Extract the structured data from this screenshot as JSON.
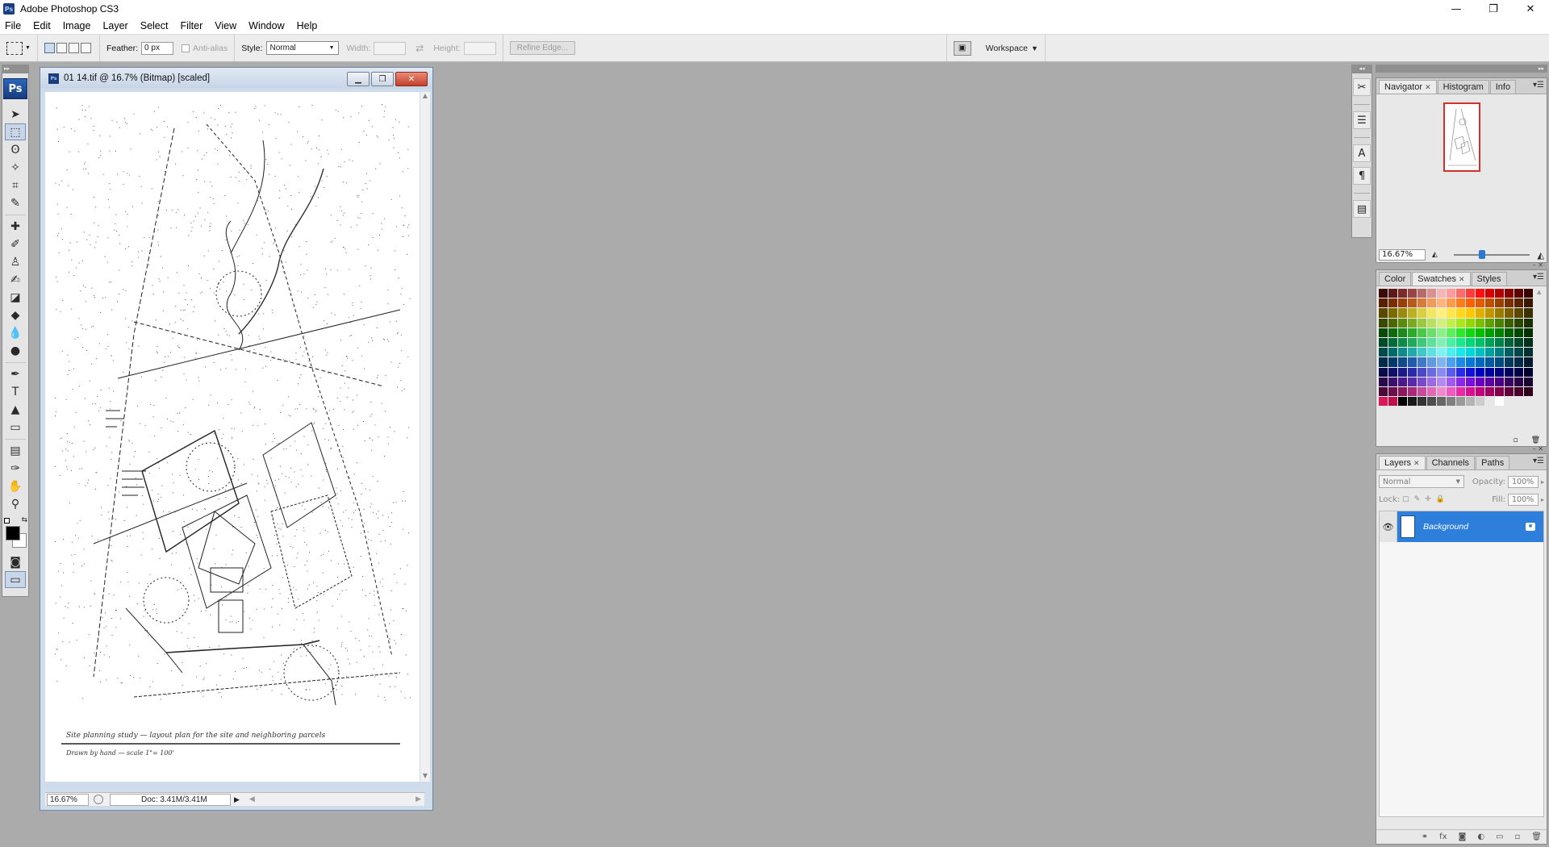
{
  "app": {
    "title": "Adobe Photoshop CS3",
    "logo": "Ps",
    "window_controls": [
      "—",
      "❐",
      "✕"
    ]
  },
  "menu": [
    "File",
    "Edit",
    "Image",
    "Layer",
    "Select",
    "Filter",
    "View",
    "Window",
    "Help"
  ],
  "options_bar": {
    "feather_label": "Feather:",
    "feather_value": "0 px",
    "antialias_label": "Anti-alias",
    "style_label": "Style:",
    "style_value": "Normal",
    "width_label": "Width:",
    "height_label": "Height:",
    "refine_edge_label": "Refine Edge...",
    "workspace_label": "Workspace"
  },
  "tools": [
    {
      "name": "move-tool-icon",
      "glyph": "➤"
    },
    {
      "name": "rectangular-marquee-tool-icon",
      "glyph": "⬚",
      "selected": true
    },
    {
      "name": "lasso-tool-icon",
      "glyph": "ʘ"
    },
    {
      "name": "magic-wand-tool-icon",
      "glyph": "✧"
    },
    {
      "name": "crop-tool-icon",
      "glyph": "⌗"
    },
    {
      "name": "slice-tool-icon",
      "glyph": "✎"
    },
    {
      "name": "healing-brush-tool-icon",
      "glyph": "✚"
    },
    {
      "name": "brush-tool-icon",
      "glyph": "✐"
    },
    {
      "name": "clone-stamp-tool-icon",
      "glyph": "♙"
    },
    {
      "name": "history-brush-tool-icon",
      "glyph": "✍"
    },
    {
      "name": "eraser-tool-icon",
      "glyph": "◪"
    },
    {
      "name": "paint-bucket-tool-icon",
      "glyph": "◆"
    },
    {
      "name": "blur-tool-icon",
      "glyph": "💧"
    },
    {
      "name": "dodge-tool-icon",
      "glyph": "●"
    },
    {
      "name": "pen-tool-icon",
      "glyph": "✒"
    },
    {
      "name": "type-tool-icon",
      "glyph": "T"
    },
    {
      "name": "path-selection-tool-icon",
      "glyph": "▲"
    },
    {
      "name": "rectangle-tool-icon",
      "glyph": "▭"
    },
    {
      "name": "notes-tool-icon",
      "glyph": "▤"
    },
    {
      "name": "eyedropper-tool-icon",
      "glyph": "✑"
    },
    {
      "name": "hand-tool-icon",
      "glyph": "✋"
    },
    {
      "name": "zoom-tool-icon",
      "glyph": "⚲"
    }
  ],
  "document": {
    "title": "01 14.tif @ 16.7% (Bitmap) [scaled]",
    "zoom": "16.67%",
    "doc_size": "Doc: 3.41M/3.41M",
    "caption_line1": "Site planning study — layout plan for the site and neighboring parcels",
    "caption_line2": "Drawn by hand — scale 1\"= 100'"
  },
  "navigator": {
    "tabs": [
      "Navigator",
      "Histogram",
      "Info"
    ],
    "zoom": "16.67%",
    "slider_fraction": 0.38
  },
  "swatches": {
    "tabs": [
      "Color",
      "Swatches",
      "Styles"
    ],
    "colors": [
      "#3d0a0a",
      "#5c1a1a",
      "#7a2b2b",
      "#9a4444",
      "#b86b6b",
      "#d89090",
      "#f2b6b6",
      "#ff9a9a",
      "#ff6b6b",
      "#ff3b3b",
      "#ff1010",
      "#d90000",
      "#b00000",
      "#870000",
      "#5e0000",
      "#3a0000",
      "#5a1e00",
      "#7a2e00",
      "#9a3e0a",
      "#ba5a1a",
      "#d87a3a",
      "#f29a5a",
      "#ffb47a",
      "#ff9a4a",
      "#ff7b1a",
      "#ff6000",
      "#e05a00",
      "#c05000",
      "#9a4000",
      "#7a3000",
      "#5a2400",
      "#3a1800",
      "#5a4a00",
      "#7a6a00",
      "#9a8a10",
      "#bab020",
      "#d8d040",
      "#f2e860",
      "#fff080",
      "#ffe84a",
      "#ffd81a",
      "#ffc800",
      "#e0b000",
      "#c09600",
      "#9a7a00",
      "#7a6000",
      "#5a4800",
      "#3a3000",
      "#3a4a00",
      "#4a6a00",
      "#5a8a10",
      "#7aaa20",
      "#9ac840",
      "#b8e060",
      "#d0f080",
      "#c0f04a",
      "#a8e81a",
      "#90d800",
      "#78c000",
      "#60a000",
      "#4a8000",
      "#386000",
      "#284800",
      "#1a3000",
      "#0a4a0a",
      "#106a10",
      "#1a8a1a",
      "#2aaa2a",
      "#4ac84a",
      "#6ae06a",
      "#8af08a",
      "#5af05a",
      "#2ae82a",
      "#10d810",
      "#00c000",
      "#00a000",
      "#008000",
      "#006000",
      "#004800",
      "#003000",
      "#004a2a",
      "#006a3a",
      "#108a4a",
      "#20aa5a",
      "#40c87a",
      "#60e09a",
      "#80f0b4",
      "#4af0a0",
      "#1ae88a",
      "#00d878",
      "#00c068",
      "#00a05a",
      "#00804a",
      "#00603a",
      "#00482a",
      "#00301a",
      "#004a4a",
      "#006a6a",
      "#108a8a",
      "#20aaaa",
      "#40c8c8",
      "#60e0e0",
      "#80f0f0",
      "#4af0f0",
      "#1ae8e8",
      "#00d8d8",
      "#00c0c0",
      "#00a0a0",
      "#008080",
      "#006060",
      "#004848",
      "#003030",
      "#002a4a",
      "#003a6a",
      "#104a8a",
      "#205aaa",
      "#407ac8",
      "#609ae0",
      "#80b4f0",
      "#4aa0f0",
      "#1a8ae8",
      "#0078d8",
      "#0068c0",
      "#005aa0",
      "#004a80",
      "#003a60",
      "#002a48",
      "#001a30",
      "#0a0a4a",
      "#10106a",
      "#1a1a8a",
      "#2a2aaa",
      "#4a4ac8",
      "#6a6ae0",
      "#8a8af0",
      "#5a5af0",
      "#2a2ae8",
      "#1010d8",
      "#0000c0",
      "#0000a0",
      "#000080",
      "#000060",
      "#000048",
      "#000030",
      "#2a0a4a",
      "#3a106a",
      "#4a1a8a",
      "#5a2aaa",
      "#7a4ac8",
      "#9a6ae0",
      "#b48af0",
      "#a05af0",
      "#8a2ae8",
      "#7810d8",
      "#6800c0",
      "#5a00a0",
      "#4a0080",
      "#3a0060",
      "#2a0048",
      "#1a0030",
      "#4a0a3a",
      "#6a104a",
      "#8a1a5a",
      "#aa2a7a",
      "#c84a9a",
      "#e06ab4",
      "#f08acc",
      "#f05ac0",
      "#e82aa8",
      "#d81090",
      "#c00078",
      "#a00060",
      "#80004a",
      "#60003a",
      "#48002a",
      "#30001a",
      "#d81a5a",
      "#c0104a",
      "#000000",
      "#1a1a1a",
      "#333333",
      "#4d4d4d",
      "#666666",
      "#808080",
      "#999999",
      "#b3b3b3",
      "#cccccc",
      "#e6e6e6",
      "#ffffff"
    ]
  },
  "layers": {
    "tabs": [
      "Layers",
      "Channels",
      "Paths"
    ],
    "blend_mode": "Normal",
    "opacity_label": "Opacity:",
    "opacity_value": "100%",
    "lock_label": "Lock:",
    "fill_label": "Fill:",
    "fill_value": "100%",
    "items": [
      {
        "name": "Background",
        "selected": true,
        "visible": true
      }
    ]
  },
  "colors": {
    "foreground": "#000000",
    "background": "#ffffff",
    "accent": "#2e7fdb",
    "workspace": "#ababab"
  }
}
